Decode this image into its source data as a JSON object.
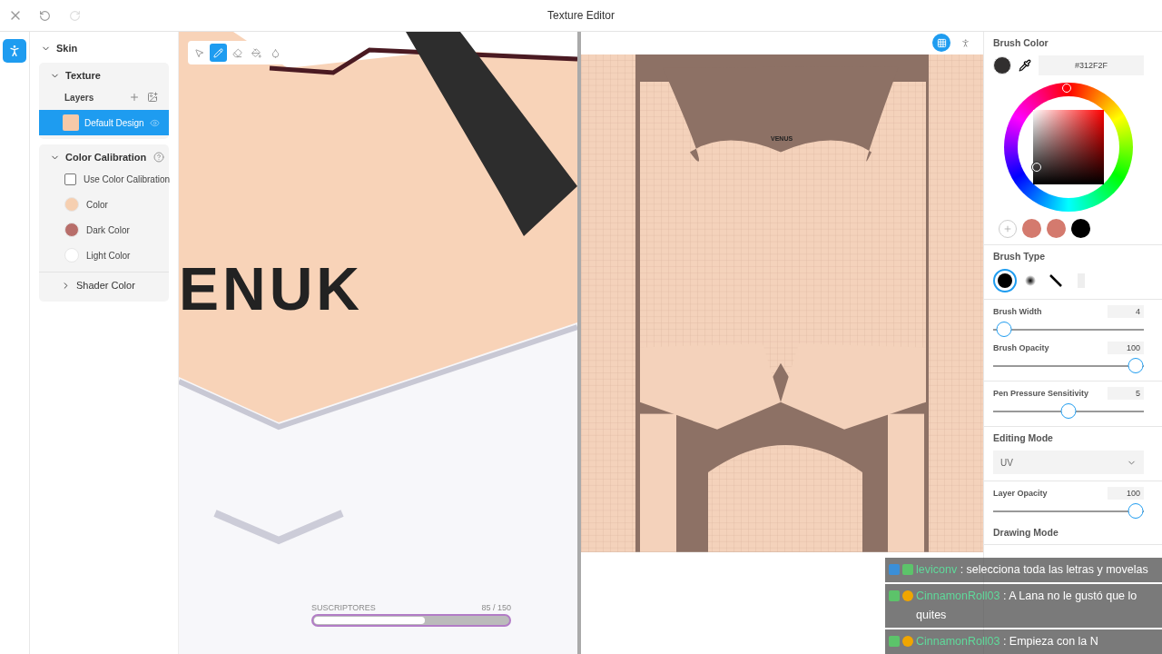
{
  "window": {
    "title": "Texture Editor"
  },
  "left_panel": {
    "root": {
      "label": "Skin",
      "expanded": true
    },
    "texture": {
      "label": "Texture",
      "expanded": true,
      "layers_label": "Layers",
      "layers": [
        {
          "name": "Default Design",
          "selected": true
        }
      ]
    },
    "calibration": {
      "label": "Color Calibration",
      "expanded": true,
      "use_label": "Use Color Calibration",
      "checked": false,
      "colors": [
        {
          "label": "Color",
          "color": "#f6cfb0"
        },
        {
          "label": "Dark Color",
          "color": "#b86e6a"
        },
        {
          "label": "Light Color",
          "color": "#ffffff"
        }
      ]
    },
    "shader": {
      "label": "Shader Color",
      "expanded": false
    }
  },
  "viewport": {
    "tools": [
      {
        "kind": "select",
        "selected": false
      },
      {
        "kind": "pen",
        "selected": true
      },
      {
        "kind": "eraser",
        "selected": false
      },
      {
        "kind": "fill",
        "selected": false
      },
      {
        "kind": "drop",
        "selected": false
      }
    ],
    "painted_text": "ENUK"
  },
  "uv_view": {
    "painted_text": "VENUS",
    "buttons": [
      {
        "kind": "grid",
        "selected": true
      },
      {
        "kind": "symmetry",
        "selected": false
      }
    ]
  },
  "right_panel": {
    "brush_color": {
      "label": "Brush Color",
      "color": "#312f2f",
      "hex": "#312F2F",
      "swatches": [
        {
          "color": "#d47a6e"
        },
        {
          "color": "#d47a6e"
        },
        {
          "color": "#000000"
        }
      ]
    },
    "brush_type": {
      "label": "Brush Type",
      "types": [
        {
          "kind": "hard",
          "selected": true
        },
        {
          "kind": "soft",
          "selected": false
        },
        {
          "kind": "line",
          "selected": false
        },
        {
          "kind": "texture",
          "selected": false
        }
      ]
    },
    "sliders": [
      {
        "label": "Brush Width",
        "value": "4",
        "level": 0.02
      },
      {
        "label": "Brush Opacity",
        "value": "100",
        "level": 1
      },
      {
        "label": "Pen Pressure Sensitivity",
        "value": "5",
        "level": 0.5
      }
    ],
    "editing_mode": {
      "label": "Editing Mode",
      "value": "UV"
    },
    "layer_opacity": {
      "label": "Layer Opacity",
      "value": "100",
      "level": 1
    },
    "drawing_mode": {
      "label": "Drawing Mode"
    }
  },
  "subscribers": {
    "label": "SUSCRIPTORES",
    "count": "85  /  150",
    "level": 0.57
  },
  "chat": [
    {
      "user": "leviconv",
      "text": " : selecciona toda las letras y movelas",
      "badges": [
        {
          "kind": "tool"
        },
        {
          "kind": "gem"
        }
      ]
    },
    {
      "user": "CinnamonRoll03",
      "text": " : A Lana no le gustó que lo quites",
      "badges": [
        {
          "kind": "gem"
        },
        {
          "kind": "coin"
        }
      ]
    },
    {
      "user": "CinnamonRoll03",
      "text": " : Empieza con la N",
      "badges": [
        {
          "kind": "gem"
        },
        {
          "kind": "coin"
        }
      ]
    }
  ]
}
